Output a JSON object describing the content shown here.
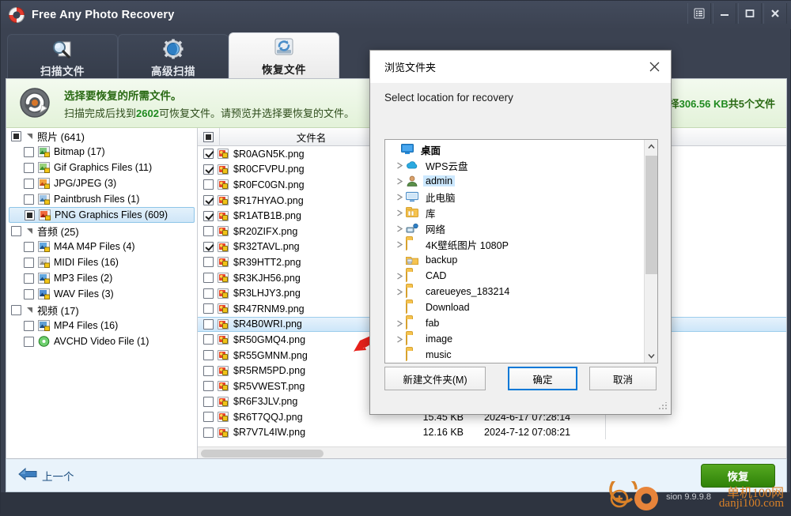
{
  "window": {
    "title": "Free Any Photo Recovery",
    "logo_icon": "lifebuoy-icon",
    "controls": [
      {
        "name": "menu-button",
        "glyph": "menu-icon"
      },
      {
        "name": "minimize-button",
        "glyph": "minimize-icon"
      },
      {
        "name": "maximize-button",
        "glyph": "maximize-icon"
      },
      {
        "name": "close-button",
        "glyph": "close-icon"
      }
    ]
  },
  "tabs": [
    {
      "label": "扫描文件",
      "icon": "magnifier-document-icon",
      "active": false
    },
    {
      "label": "高级扫描",
      "icon": "gear-icon",
      "active": false
    },
    {
      "label": "恢复文件",
      "icon": "recover-drive-icon",
      "active": true
    }
  ],
  "banner": {
    "icon": "recycle-arrow-icon",
    "title": "选择要恢复的所需文件。",
    "desc_prefix": "扫描完成后找到",
    "desc_count": "2602",
    "desc_suffix": "可恢复文件。请预览并选择要恢复的文件。",
    "selection_prefix": "选择",
    "selection_size": "306.56 KB",
    "selection_suffix": "共5个文件"
  },
  "sidebar": {
    "items": [
      {
        "label": "照片 (641)",
        "level": 0,
        "checkbox": "partial",
        "expander": "expanded",
        "icon": null,
        "selected": false
      },
      {
        "label": "Bitmap (17)",
        "level": 1,
        "checkbox": "unchecked",
        "expander": "none",
        "icon": "bitmap-file-icon",
        "selected": false
      },
      {
        "label": "Gif Graphics Files (11)",
        "level": 1,
        "checkbox": "unchecked",
        "expander": "none",
        "icon": "gif-file-icon",
        "selected": false
      },
      {
        "label": "JPG/JPEG (3)",
        "level": 1,
        "checkbox": "unchecked",
        "expander": "none",
        "icon": "jpg-file-icon",
        "selected": false
      },
      {
        "label": "Paintbrush Files (1)",
        "level": 1,
        "checkbox": "unchecked",
        "expander": "none",
        "icon": "paintbrush-file-icon",
        "selected": false
      },
      {
        "label": "PNG Graphics Files (609)",
        "level": 1,
        "checkbox": "partial",
        "expander": "none",
        "icon": "png-file-icon",
        "selected": true
      },
      {
        "label": "音频 (25)",
        "level": 0,
        "checkbox": "unchecked",
        "expander": "expanded",
        "icon": null,
        "selected": false
      },
      {
        "label": "M4A M4P Files (4)",
        "level": 1,
        "checkbox": "unchecked",
        "expander": "none",
        "icon": "m4a-file-icon",
        "selected": false
      },
      {
        "label": "MIDI Files (16)",
        "level": 1,
        "checkbox": "unchecked",
        "expander": "none",
        "icon": "midi-file-icon",
        "selected": false
      },
      {
        "label": "MP3 Files (2)",
        "level": 1,
        "checkbox": "unchecked",
        "expander": "none",
        "icon": "mp3-file-icon",
        "selected": false
      },
      {
        "label": "WAV Files (3)",
        "level": 1,
        "checkbox": "unchecked",
        "expander": "none",
        "icon": "wav-file-icon",
        "selected": false
      },
      {
        "label": "视频 (17)",
        "level": 0,
        "checkbox": "unchecked",
        "expander": "expanded",
        "icon": null,
        "selected": false
      },
      {
        "label": "MP4 Files (16)",
        "level": 1,
        "checkbox": "unchecked",
        "expander": "none",
        "icon": "mp4-file-icon",
        "selected": false
      },
      {
        "label": "AVCHD Video File (1)",
        "level": 1,
        "checkbox": "unchecked",
        "expander": "none",
        "icon": "avchd-file-icon",
        "selected": false
      }
    ]
  },
  "filelist": {
    "columns": {
      "check": "",
      "name": "文件名",
      "size": "",
      "date": ""
    },
    "header_checkbox": "partial",
    "rows": [
      {
        "name": "$R0AGN5K.png",
        "checked": true,
        "selected": false,
        "size": "",
        "date": ""
      },
      {
        "name": "$R0CFVPU.png",
        "checked": true,
        "selected": false,
        "size": "",
        "date": ""
      },
      {
        "name": "$R0FC0GN.png",
        "checked": false,
        "selected": false,
        "size": "",
        "date": ""
      },
      {
        "name": "$R17HYAO.png",
        "checked": true,
        "selected": false,
        "size": "",
        "date": ""
      },
      {
        "name": "$R1ATB1B.png",
        "checked": true,
        "selected": false,
        "size": "",
        "date": ""
      },
      {
        "name": "$R20ZIFX.png",
        "checked": false,
        "selected": false,
        "size": "",
        "date": ""
      },
      {
        "name": "$R32TAVL.png",
        "checked": true,
        "selected": false,
        "size": "",
        "date": ""
      },
      {
        "name": "$R39HTT2.png",
        "checked": false,
        "selected": false,
        "size": "",
        "date": ""
      },
      {
        "name": "$R3KJH56.png",
        "checked": false,
        "selected": false,
        "size": "",
        "date": ""
      },
      {
        "name": "$R3LHJY3.png",
        "checked": false,
        "selected": false,
        "size": "",
        "date": ""
      },
      {
        "name": "$R47RNM9.png",
        "checked": false,
        "selected": false,
        "size": "",
        "date": ""
      },
      {
        "name": "$R4B0WRI.png",
        "checked": false,
        "selected": true,
        "size": "",
        "date": ""
      },
      {
        "name": "$R50GMQ4.png",
        "checked": false,
        "selected": false,
        "size": "",
        "date": ""
      },
      {
        "name": "$R55GMNM.png",
        "checked": false,
        "selected": false,
        "size": "",
        "date": ""
      },
      {
        "name": "$R5RM5PD.png",
        "checked": false,
        "selected": false,
        "size": "",
        "date": ""
      },
      {
        "name": "$R5VWEST.png",
        "checked": false,
        "selected": false,
        "size": "",
        "date": ""
      },
      {
        "name": "$R6F3JLV.png",
        "checked": false,
        "selected": false,
        "size": "",
        "date": ""
      },
      {
        "name": "$R6T7QQJ.png",
        "checked": false,
        "selected": false,
        "size": "15.45 KB",
        "date": "2024-6-17 07:28:14"
      },
      {
        "name": "$R7V7L4IW.png",
        "checked": false,
        "selected": false,
        "size": "12.16 KB",
        "date": "2024-7-12 07:08:21"
      }
    ]
  },
  "bottom": {
    "back_label": "上一个",
    "back_icon": "arrow-left-icon",
    "recover_label": "恢复"
  },
  "status": {
    "version": "sion 9.9.9.8",
    "watermark_line1": "单机100网",
    "watermark_line2": "danji100.com"
  },
  "dialog": {
    "title": "浏览文件夹",
    "close_icon": "close-icon",
    "prompt": "Select location for recovery",
    "tree": [
      {
        "label": "桌面",
        "indent": 0,
        "expander": "none",
        "icon": "desktop-icon",
        "selected": false
      },
      {
        "label": "WPS云盘",
        "indent": 1,
        "expander": "collapsed",
        "icon": "cloud-icon",
        "selected": false
      },
      {
        "label": "admin",
        "indent": 1,
        "expander": "collapsed",
        "icon": "user-icon",
        "selected": true
      },
      {
        "label": "此电脑",
        "indent": 1,
        "expander": "collapsed",
        "icon": "computer-icon",
        "selected": false
      },
      {
        "label": "库",
        "indent": 1,
        "expander": "collapsed",
        "icon": "library-icon",
        "selected": false
      },
      {
        "label": "网络",
        "indent": 1,
        "expander": "collapsed",
        "icon": "network-icon",
        "selected": false
      },
      {
        "label": "4K壁纸图片 1080P",
        "indent": 1,
        "expander": "collapsed",
        "icon": "folder-icon",
        "selected": false
      },
      {
        "label": "backup",
        "indent": 1,
        "expander": "none",
        "icon": "shared-folder-icon",
        "selected": false
      },
      {
        "label": "CAD",
        "indent": 1,
        "expander": "collapsed",
        "icon": "folder-icon",
        "selected": false
      },
      {
        "label": "careueyes_183214",
        "indent": 1,
        "expander": "collapsed",
        "icon": "folder-icon",
        "selected": false
      },
      {
        "label": "Download",
        "indent": 1,
        "expander": "none",
        "icon": "folder-icon",
        "selected": false
      },
      {
        "label": "fab",
        "indent": 1,
        "expander": "collapsed",
        "icon": "folder-icon",
        "selected": false
      },
      {
        "label": "image",
        "indent": 1,
        "expander": "collapsed",
        "icon": "folder-icon",
        "selected": false
      },
      {
        "label": "music",
        "indent": 1,
        "expander": "none",
        "icon": "folder-icon",
        "selected": false
      }
    ],
    "buttons": {
      "new_folder": "新建文件夹(M)",
      "ok": "确定",
      "cancel": "取消"
    }
  },
  "colors": {
    "chrome": "#3b4251",
    "banner": "#e3f2d9",
    "banner_text": "#2a6a14",
    "accent_green": "#2f8208",
    "selection_blue": "#cce8ff",
    "focus_blue": "#0078d7",
    "pointer_red": "#e8211b"
  }
}
